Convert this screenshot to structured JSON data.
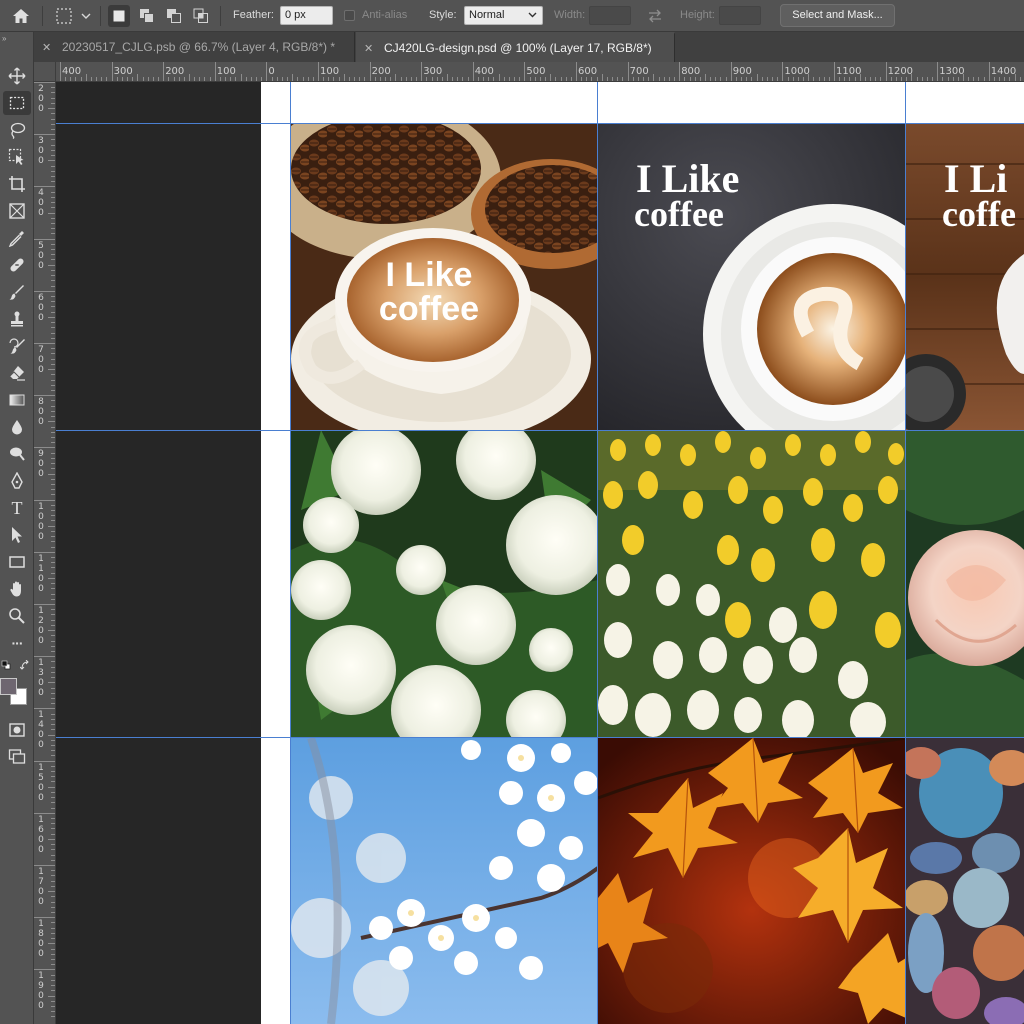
{
  "options_bar": {
    "feather_label": "Feather:",
    "feather_value": "0 px",
    "antialias_label": "Anti-alias",
    "style_label": "Style:",
    "style_value": "Normal",
    "width_label": "Width:",
    "height_label": "Height:",
    "select_mask_label": "Select and Mask..."
  },
  "tabs": [
    {
      "label": "20230517_CJLG.psb @ 66.7% (Layer 4, RGB/8*) *",
      "active": false
    },
    {
      "label": "CJ420LG-design.psd @ 100% (Layer 17, RGB/8*)",
      "active": true
    }
  ],
  "toolbar": {
    "collapse_glyph": "»",
    "tools": [
      "move-tool",
      "rectangular-marquee-tool",
      "lasso-tool",
      "object-selection-tool",
      "crop-tool",
      "frame-tool",
      "eyedropper-tool",
      "spot-healing-brush-tool",
      "brush-tool",
      "clone-stamp-tool",
      "history-brush-tool",
      "eraser-tool",
      "gradient-tool",
      "blur-tool",
      "dodge-tool",
      "pen-tool",
      "type-tool",
      "path-selection-tool",
      "rectangle-tool",
      "hand-tool",
      "zoom-tool",
      "edit-toolbar"
    ],
    "type_tool_glyph": "T",
    "more_glyph": "···",
    "foreground_color": "#6e6670",
    "background_color": "#ffffff"
  },
  "rulers": {
    "horizontal_labels": [
      "400",
      "300",
      "200",
      "100",
      "0",
      "100",
      "200",
      "300",
      "400",
      "500",
      "600",
      "700",
      "800",
      "900",
      "1000",
      "1100",
      "1200",
      "1300",
      "1400"
    ],
    "vertical_labels": [
      "200",
      "300",
      "400",
      "500",
      "600",
      "700",
      "800",
      "900",
      "1000",
      "1100",
      "1200",
      "1300",
      "1400",
      "1500",
      "1600",
      "1700",
      "1800",
      "1900"
    ]
  },
  "canvas": {
    "tiles": [
      {
        "name": "coffee-latte-tile",
        "overlay_line1": "I Like",
        "overlay_line2": "coffee"
      },
      {
        "name": "coffee-slate-tile",
        "overlay_line1": "I Like",
        "overlay_line2": "coffee"
      },
      {
        "name": "coffee-wood-tile",
        "overlay_line1": "I Li",
        "overlay_line2": "coffe"
      },
      {
        "name": "white-roses-tile"
      },
      {
        "name": "tulips-tile"
      },
      {
        "name": "pink-rose-tile"
      },
      {
        "name": "cherry-blossom-tile"
      },
      {
        "name": "maple-leaves-tile"
      },
      {
        "name": "pebbles-tile"
      }
    ],
    "guide_color": "#4a7fd1"
  }
}
